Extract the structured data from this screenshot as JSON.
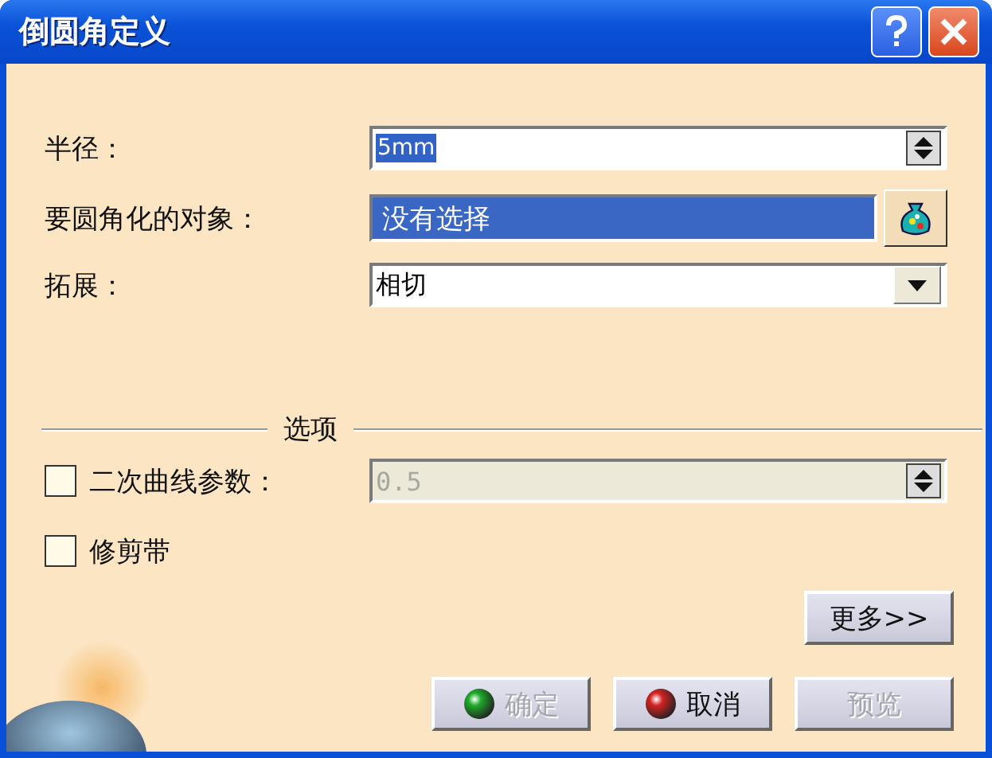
{
  "window": {
    "title": "倒圆角定义"
  },
  "fields": [
    {
      "kind": "spinner",
      "label": "半径：",
      "value": "5mm",
      "highlighted": true
    },
    {
      "kind": "selection",
      "label": "要圆角化的对象：",
      "value": "没有选择"
    },
    {
      "kind": "dropdown",
      "label": "拓展：",
      "value": "相切"
    }
  ],
  "options": {
    "title": "选项",
    "items": [
      {
        "kind": "spinner",
        "label": "二次曲线参数：",
        "checked": false,
        "value": "0.5",
        "disabled": true
      },
      {
        "kind": "plain",
        "label": "修剪带",
        "checked": false
      }
    ]
  },
  "more_button": "更多>>",
  "buttons": [
    {
      "kind": "ok",
      "label": "确定",
      "disabled": true
    },
    {
      "kind": "cancel",
      "label": "取消",
      "disabled": false
    },
    {
      "kind": "plain",
      "label": "预览",
      "disabled": true
    }
  ]
}
